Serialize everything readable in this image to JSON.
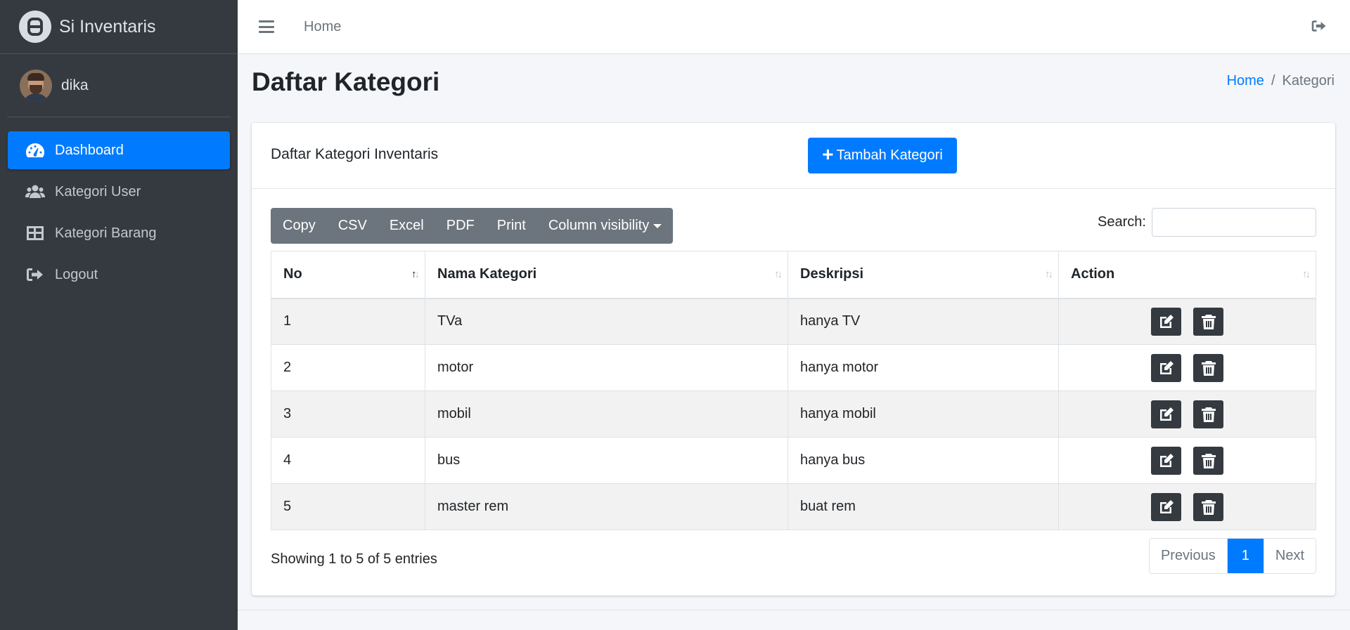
{
  "brand": {
    "name": "Si Inventaris",
    "logo_icon": "app-logo-icon"
  },
  "user": {
    "name": "dika"
  },
  "sidebar": {
    "items": [
      {
        "label": "Dashboard",
        "icon": "tachometer-icon",
        "active": true
      },
      {
        "label": "Kategori User",
        "icon": "users-icon"
      },
      {
        "label": "Kategori Barang",
        "icon": "table-icon"
      },
      {
        "label": "Logout",
        "icon": "sign-out-icon"
      }
    ]
  },
  "topbar": {
    "home_label": "Home"
  },
  "page": {
    "title": "Daftar Kategori"
  },
  "breadcrumb": {
    "home": "Home",
    "separator": "/",
    "current": "Kategori"
  },
  "card": {
    "title": "Daftar Kategori Inventaris",
    "add_button_label": "Tambah Kategori"
  },
  "table_tools": {
    "buttons": [
      "Copy",
      "CSV",
      "Excel",
      "PDF",
      "Print",
      "Column visibility"
    ],
    "search_label": "Search:",
    "search_value": ""
  },
  "table": {
    "columns": [
      "No",
      "Nama Kategori",
      "Deskripsi",
      "Action"
    ],
    "rows": [
      {
        "no": "1",
        "nama": "TVa",
        "deskripsi": "hanya TV"
      },
      {
        "no": "2",
        "nama": "motor",
        "deskripsi": "hanya motor"
      },
      {
        "no": "3",
        "nama": "mobil",
        "deskripsi": "hanya mobil"
      },
      {
        "no": "4",
        "nama": "bus",
        "deskripsi": "hanya bus"
      },
      {
        "no": "5",
        "nama": "master rem",
        "deskripsi": "buat rem"
      }
    ]
  },
  "pagination": {
    "info": "Showing 1 to 5 of 5 entries",
    "previous": "Previous",
    "current": "1",
    "next": "Next"
  },
  "colors": {
    "primary": "#007bff",
    "sidebar_bg": "#343a40",
    "secondary": "#6c757d"
  }
}
